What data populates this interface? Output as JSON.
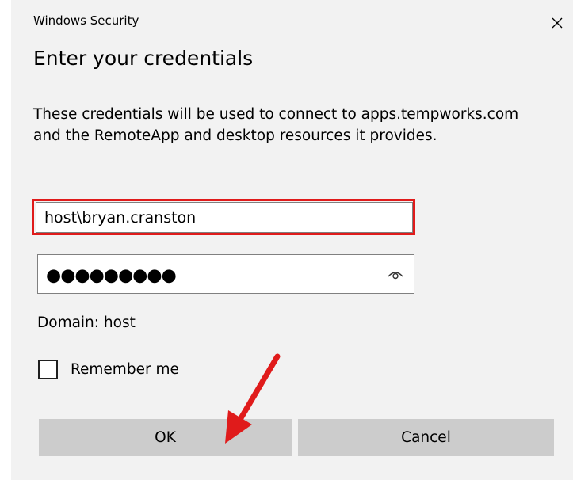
{
  "window": {
    "title": "Windows Security"
  },
  "dialog": {
    "heading": "Enter your credentials",
    "description": "These credentials will be used to connect to apps.tempworks.com and the RemoteApp and desktop resources it provides."
  },
  "fields": {
    "username_value": "host\\bryan.cranston",
    "password_masked": "●●●●●●●●●",
    "domain_label": "Domain: host"
  },
  "remember": {
    "label": "Remember me",
    "checked": false
  },
  "buttons": {
    "ok_label": "OK",
    "cancel_label": "Cancel"
  },
  "icons": {
    "close": "close-icon",
    "reveal_password": "eye-icon",
    "annotation": "arrow-annotation"
  },
  "colors": {
    "dialog_background": "#f2f2f2",
    "button_background": "#cccccc",
    "highlight_border": "#e01b1b",
    "field_border": "#808080"
  }
}
